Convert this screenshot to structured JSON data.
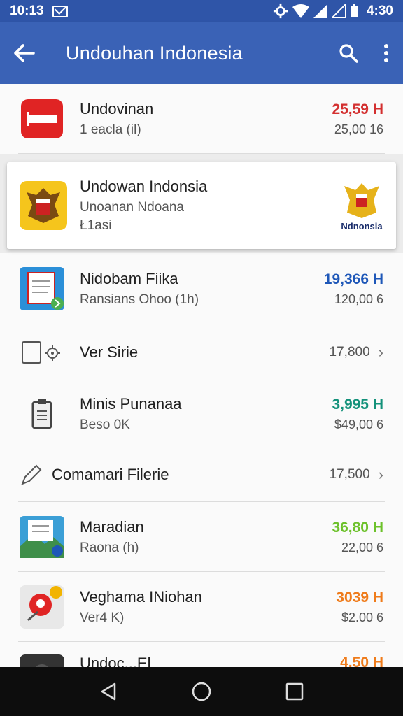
{
  "status_bar": {
    "time": "10:13",
    "clock_right": "4:30"
  },
  "app_bar": {
    "title": "Undouhan Indonesia"
  },
  "items": [
    {
      "title": "Undovinan",
      "sub": "1 eacla (il)",
      "price": "25,59 H",
      "price_color": "#d32f2f",
      "price2": "25,00 16"
    },
    {
      "title": "Undowan Indonsia",
      "sub": "Unoanan Ndoana",
      "sub2": "Ł1asi",
      "badge_text": "Ndnonsia"
    },
    {
      "title": "Nidobam Fiika",
      "sub": "Ransians Ohoo (1h)",
      "price": "19,366 H",
      "price_color": "#1e57b8",
      "price2": "120,00 6"
    },
    {
      "title": "Ver Sirie",
      "value": "17,800"
    },
    {
      "title": "Minis Punanaa",
      "sub": "Beso 0K",
      "price": "3,995 H",
      "price_color": "#13917a",
      "price2": "$49,00 6"
    },
    {
      "title": "Comamari Filerie",
      "value": "17,500"
    },
    {
      "title": "Maradian",
      "sub": "Raona (h)",
      "price": "36,80 H",
      "price_color": "#6cc12a",
      "price2": "22,00 6"
    },
    {
      "title": "Veghama INiohan",
      "sub": "Ver4 K)",
      "price": "3039 H",
      "price_color": "#ef7b1a",
      "price2": "$2.00 6"
    },
    {
      "title": "Undoc...El",
      "price": "4,50 H",
      "price_color": "#ef7b1a"
    }
  ],
  "icons": {
    "back": "arrow-left-icon",
    "search": "search-icon",
    "more": "more-vert-icon",
    "nav_back": "triangle-back-icon",
    "nav_home": "circle-home-icon",
    "nav_recents": "square-recents-icon"
  }
}
